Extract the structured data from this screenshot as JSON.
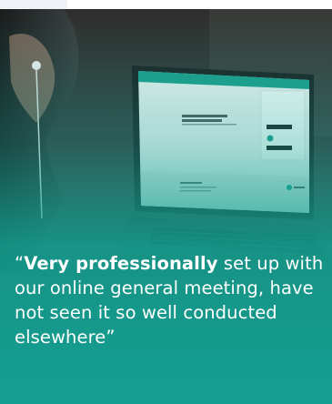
{
  "testimonial": {
    "open_mark": "“",
    "bold_text": "Very professionally",
    "rest_text": " set up with our online general meeting, have not seen it so well conducted elsewhere",
    "close_mark": "”"
  },
  "screen": {
    "brand": "VP SECURITIES",
    "welcome_title": "Velkommen til elektronisk generalforsamling",
    "login_title": "Elektronisk generalforsamling",
    "footer_title": "Kontakt"
  },
  "colors": {
    "teal": "#1f9e8d",
    "overlay_bottom": "#13a394"
  }
}
